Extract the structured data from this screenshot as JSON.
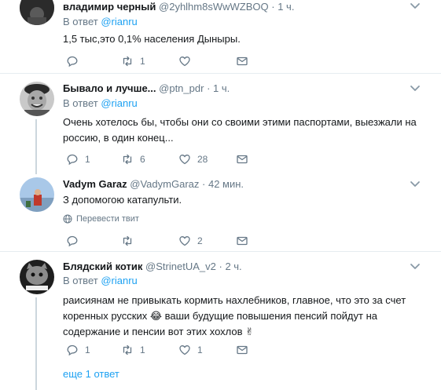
{
  "tweets": [
    {
      "name": "владимир черный",
      "handle": "@2yhlhm8sWwWZBOQ",
      "dot": "·",
      "time": "1 ч.",
      "reply_prefix": "В ответ",
      "reply_to": "@rianru",
      "text": "1,5 тыс,это 0,1% населения Дыныры.",
      "replies": "",
      "retweets": "1",
      "likes": ""
    },
    {
      "name": "Бывало и лучше...",
      "handle": "@ptn_pdr",
      "dot": "·",
      "time": "1 ч.",
      "reply_prefix": "В ответ",
      "reply_to": "@rianru",
      "text": "Очень хотелось бы, чтобы они со своими этими паспортами, выезжали на россию, в один конец...",
      "replies": "1",
      "retweets": "6",
      "likes": "28"
    },
    {
      "name": "Vadym Garaz",
      "handle": "@VadymGaraz",
      "dot": "·",
      "time": "42 мин.",
      "text": "З допомогою катапульти.",
      "translate": "Перевести твит",
      "replies": "",
      "retweets": "",
      "likes": "2"
    },
    {
      "name": "Блядский котик",
      "handle": "@StrinetUA_v2",
      "dot": "·",
      "time": "2 ч.",
      "reply_prefix": "В ответ",
      "reply_to": "@rianru",
      "text": "раисиянам не привыкать кормить нахлебников, главное, что это за счет коренных русских 😂 ваши будущие повышения пенсий пойдут на содержание и пенсии вот этих хохлов ✌",
      "replies": "1",
      "retweets": "1",
      "likes": "1"
    }
  ],
  "more_replies": "еще 1 ответ",
  "colors": {
    "link": "#1da1f2",
    "muted": "#657786",
    "divider": "#e6ecf0",
    "thread": "#ccd6dd"
  }
}
